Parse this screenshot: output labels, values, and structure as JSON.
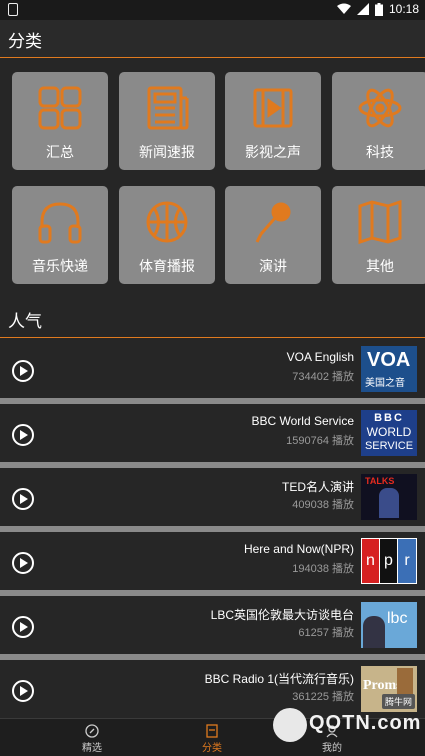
{
  "status_bar": {
    "time": "10:18"
  },
  "header": {
    "title": "分类"
  },
  "categories": [
    {
      "label": "汇总",
      "icon": "grid-squares-icon"
    },
    {
      "label": "新闻速报",
      "icon": "newspaper-icon"
    },
    {
      "label": "影视之声",
      "icon": "film-icon"
    },
    {
      "label": "科技",
      "icon": "atom-icon"
    },
    {
      "label": "音乐快递",
      "icon": "headphones-icon"
    },
    {
      "label": "体育播报",
      "icon": "basketball-icon"
    },
    {
      "label": "演讲",
      "icon": "microphone-icon"
    },
    {
      "label": "其他",
      "icon": "map-icon"
    }
  ],
  "popular": {
    "title": "人气",
    "items": [
      {
        "name": "VOA English",
        "plays": "734402 播放",
        "thumb": "voa-logo"
      },
      {
        "name": "BBC World Service",
        "plays": "1590764 播放",
        "thumb": "bbc-logo"
      },
      {
        "name": "TED名人演讲",
        "plays": "409038 播放",
        "thumb": "ted-logo"
      },
      {
        "name": "Here and Now(NPR)",
        "plays": "194038 播放",
        "thumb": "npr-logo"
      },
      {
        "name": "LBC英国伦敦最大访谈电台",
        "plays": "61257 播放",
        "thumb": "lbc-logo"
      },
      {
        "name": "BBC Radio 1(当代流行音乐)",
        "plays": "361225 播放",
        "thumb": "proms-logo"
      }
    ]
  },
  "thumb_text": {
    "voa": "VOA",
    "voa_cn": "美国之音",
    "bbc1": "BBC",
    "bbc2": "WORLD",
    "bbc3": "SERVICE",
    "ted": "TALKS",
    "npr_n": "n",
    "npr_p": "p",
    "npr_r": "r",
    "lbc": "lbc",
    "proms": "Proms"
  },
  "tabs": [
    {
      "label": "精选",
      "active": false
    },
    {
      "label": "分类",
      "active": true
    },
    {
      "label": "我的",
      "active": false
    }
  ],
  "watermark": {
    "text": "QOTN.com",
    "badge": "腾牛网"
  },
  "colors": {
    "accent": "#e07a1f",
    "tile": "#8a8a8a",
    "background": "#262626"
  }
}
